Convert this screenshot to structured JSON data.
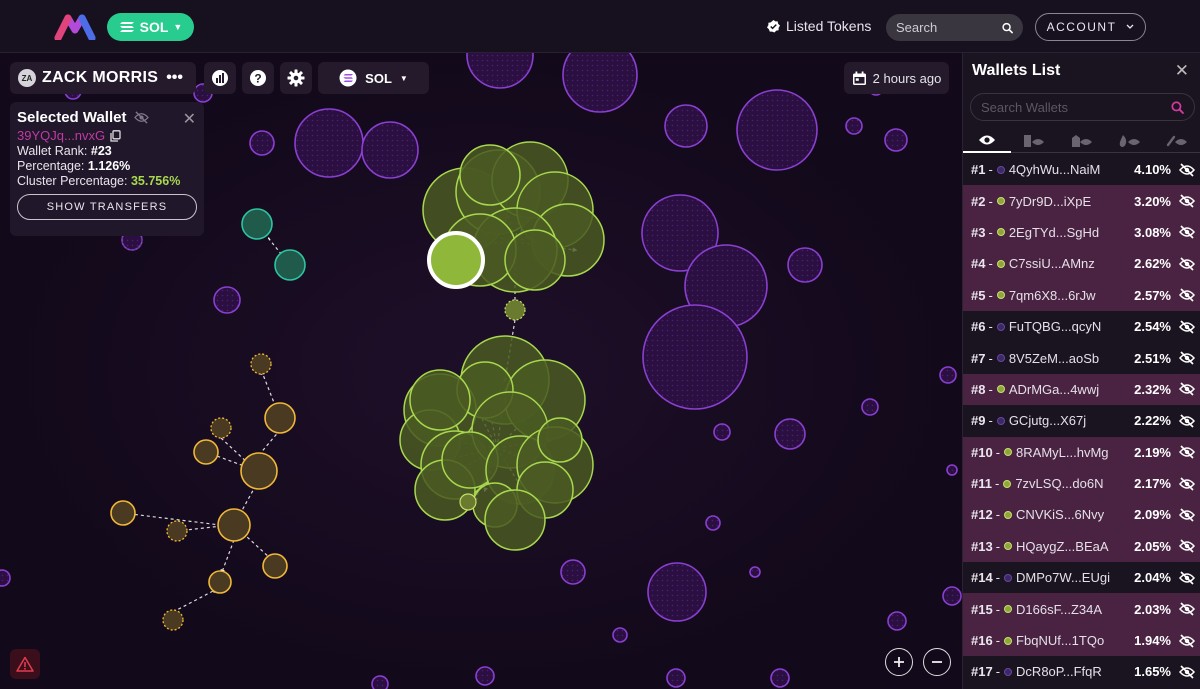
{
  "header": {
    "chain_label": "SOL",
    "listed_tokens_label": "Listed Tokens",
    "search_placeholder": "Search",
    "account_label": "ACCOUNT"
  },
  "toolbar": {
    "avatar_initials": "ZA",
    "wallet_name": "ZACK MORRIS",
    "more_label": "•••",
    "chain_select_label": "SOL",
    "time_label": "2 hours ago"
  },
  "selected_wallet": {
    "title": "Selected Wallet",
    "address": "39YQJq...nvxG",
    "rank_label": "Wallet Rank:",
    "rank_value": "#23",
    "percentage_label": "Percentage:",
    "percentage_value": "1.126%",
    "cluster_label": "Cluster Percentage:",
    "cluster_value": "35.756%",
    "show_transfers_label": "SHOW TRANSFERS"
  },
  "wallets_list": {
    "title": "Wallets List",
    "search_placeholder": "Search Wallets",
    "rows": [
      {
        "rank": "#1",
        "address": "4QyhWu...NaiM",
        "pct": "4.10%",
        "dot": "#3a2a60",
        "alt": false
      },
      {
        "rank": "#2",
        "address": "7yDr9D...iXpE",
        "pct": "3.20%",
        "dot": "#8fa63a",
        "alt": true
      },
      {
        "rank": "#3",
        "address": "2EgTYd...SgHd",
        "pct": "3.08%",
        "dot": "#8fa63a",
        "alt": true
      },
      {
        "rank": "#4",
        "address": "C7ssiU...AMnz",
        "pct": "2.62%",
        "dot": "#8fa63a",
        "alt": true
      },
      {
        "rank": "#5",
        "address": "7qm6X8...6rJw",
        "pct": "2.57%",
        "dot": "#8fa63a",
        "alt": true
      },
      {
        "rank": "#6",
        "address": "FuTQBG...qcyN",
        "pct": "2.54%",
        "dot": "#3a2a60",
        "alt": false
      },
      {
        "rank": "#7",
        "address": "8V5ZeM...aoSb",
        "pct": "2.51%",
        "dot": "#3a2a60",
        "alt": false
      },
      {
        "rank": "#8",
        "address": "ADrMGa...4wwj",
        "pct": "2.32%",
        "dot": "#8fa63a",
        "alt": true
      },
      {
        "rank": "#9",
        "address": "GCjutg...X67j",
        "pct": "2.22%",
        "dot": "#3a2a60",
        "alt": false
      },
      {
        "rank": "#10",
        "address": "8RAMyL...hvMg",
        "pct": "2.19%",
        "dot": "#8fa63a",
        "alt": true
      },
      {
        "rank": "#11",
        "address": "7zvLSQ...do6N",
        "pct": "2.17%",
        "dot": "#8fa63a",
        "alt": true
      },
      {
        "rank": "#12",
        "address": "CNVKiS...6Nvy",
        "pct": "2.09%",
        "dot": "#8fa63a",
        "alt": true
      },
      {
        "rank": "#13",
        "address": "HQaygZ...BEaA",
        "pct": "2.05%",
        "dot": "#8fa63a",
        "alt": true
      },
      {
        "rank": "#14",
        "address": "DMPo7W...EUgi",
        "pct": "2.04%",
        "dot": "#3a2a60",
        "alt": false
      },
      {
        "rank": "#15",
        "address": "D166sF...Z34A",
        "pct": "2.03%",
        "dot": "#8fa63a",
        "alt": true
      },
      {
        "rank": "#16",
        "address": "FbqNUf...1TQo",
        "pct": "1.94%",
        "dot": "#8fa63a",
        "alt": true
      },
      {
        "rank": "#17",
        "address": "DcR8oP...FfqR",
        "pct": "1.65%",
        "dot": "#3a2a60",
        "alt": false
      }
    ]
  },
  "colors": {
    "accent_green": "#27cc8e",
    "cluster_green": "#a8d84e",
    "purple_bubble": "#8a3fd1",
    "teal_bubble": "#2ec4a0",
    "orange_bubble": "#f0b838",
    "highlight_row": "#4a2343",
    "address_pink": "#c03aa3"
  },
  "icons": {
    "logo": "bubblemaps-logo",
    "verified": "verified-badge-icon",
    "search": "search-icon",
    "chevron": "chevron-down-icon",
    "stats": "chart-icon",
    "help": "help-icon",
    "settings": "gear-icon",
    "calendar": "calendar-icon",
    "hide": "eye-off-icon",
    "copy": "copy-icon",
    "close": "close-icon",
    "warning": "warning-icon",
    "zoom_in": "zoom-in-icon",
    "zoom_out": "zoom-out-icon"
  }
}
